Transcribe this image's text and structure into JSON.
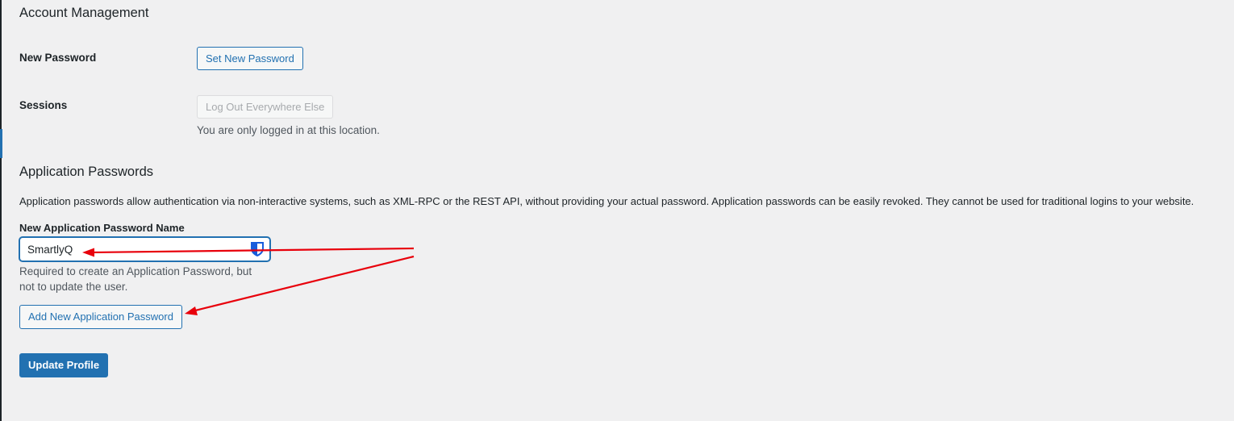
{
  "account_management": {
    "title": "Account Management",
    "new_password_label": "New Password",
    "set_new_password_button": "Set New Password",
    "sessions_label": "Sessions",
    "logout_everywhere_button": "Log Out Everywhere Else",
    "sessions_note": "You are only logged in at this location."
  },
  "application_passwords": {
    "title": "Application Passwords",
    "description": "Application passwords allow authentication via non-interactive systems, such as XML-RPC or the REST API, without providing your actual password. Application passwords can be easily revoked. They cannot be used for traditional logins to your website.",
    "name_field_label": "New Application Password Name",
    "name_field_value": "SmartlyQ",
    "name_field_help": "Required to create an Application Password, but not to update the user.",
    "add_button": "Add New Application Password"
  },
  "update_profile_button": "Update Profile",
  "colors": {
    "accent": "#2271b1",
    "background": "#f0f0f1",
    "annotation_arrow": "#e8000b",
    "shield_icon": "#175ddc"
  },
  "icons": {
    "password_manager": "shield-icon"
  }
}
